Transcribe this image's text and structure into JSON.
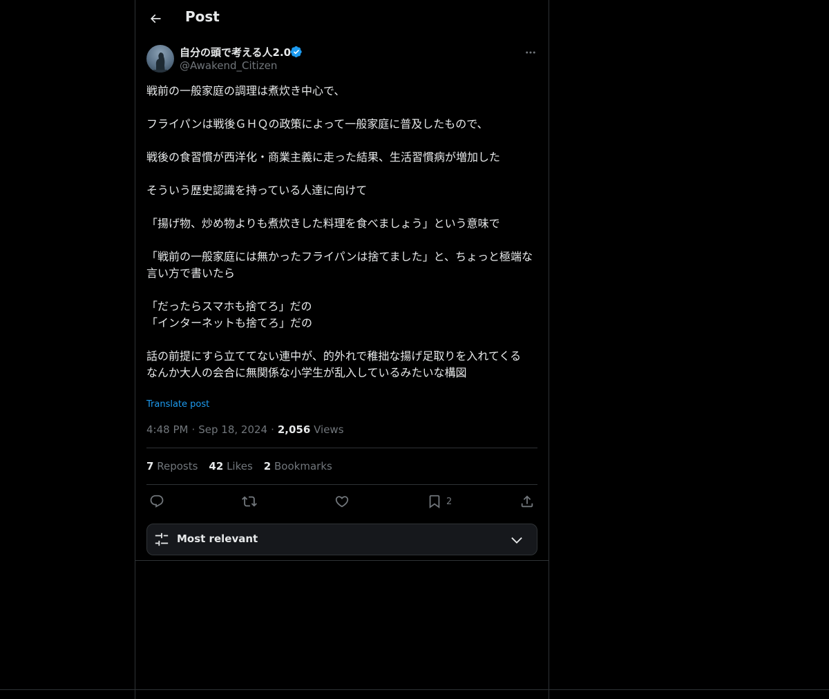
{
  "header": {
    "title": "Post"
  },
  "author": {
    "display_name": "自分の頭で考える人2.0",
    "handle": "@Awakend_Citizen",
    "verified_color": "#1d9bf0"
  },
  "post": {
    "paragraphs": [
      "戦前の一般家庭の調理は煮炊き中心で、",
      "フライパンは戦後ＧＨＱの政策によって一般家庭に普及したもので、",
      "戦後の食習慣が西洋化・商業主義に走った結果、生活習慣病が増加した",
      "そういう歴史認識を持っている人達に向けて",
      "「揚げ物、炒め物よりも煮炊きした料理を食べましょう」という意味で",
      "「戦前の一般家庭には無かったフライパンは捨てました」と、ちょっと極端な言い方で書いたら",
      "「だったらスマホも捨てろ」だの\n「インターネットも捨てろ」だの",
      "話の前提にすら立ててない連中が、的外れで稚拙な揚げ足取りを入れてくる\nなんか大人の会合に無関係な小学生が乱入しているみたいな構図"
    ],
    "translate_label": "Translate post",
    "time": "4:48 PM",
    "date": "Sep 18, 2024",
    "views_count": "2,056",
    "views_label": "Views"
  },
  "stats": {
    "reposts_count": "7",
    "reposts_label": "Reposts",
    "likes_count": "42",
    "likes_label": "Likes",
    "bookmarks_count": "2",
    "bookmarks_label": "Bookmarks"
  },
  "actions": {
    "bookmark_count": "2"
  },
  "sort": {
    "label": "Most relevant"
  },
  "colors": {
    "background": "#000000",
    "text": "#e7e9ea",
    "muted": "#71767b",
    "border": "#2f3336",
    "accent": "#1d9bf0"
  },
  "icons": [
    "back-arrow-icon",
    "verified-badge-icon",
    "more-icon",
    "reply-icon",
    "repost-icon",
    "like-icon",
    "bookmark-icon",
    "share-icon",
    "sort-filter-icon",
    "chevron-down-icon"
  ]
}
